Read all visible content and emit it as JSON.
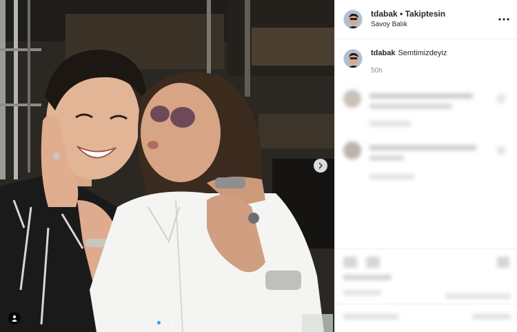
{
  "header": {
    "username": "tdabak",
    "separator": "•",
    "follow_status": "Takiptesin",
    "location": "Savoy Balık"
  },
  "caption": {
    "username": "tdabak",
    "text": "Semtimizdeyiz",
    "time": "50h"
  },
  "carousel": {
    "dot_count": 3,
    "active_index": 0
  },
  "colors": {
    "accent": "#3897f0",
    "text_primary": "#262626",
    "text_secondary": "#8e8e8e",
    "divider": "#efefef"
  },
  "icons": [
    "more-options-icon",
    "chevron-right-icon",
    "user-tag-icon"
  ]
}
